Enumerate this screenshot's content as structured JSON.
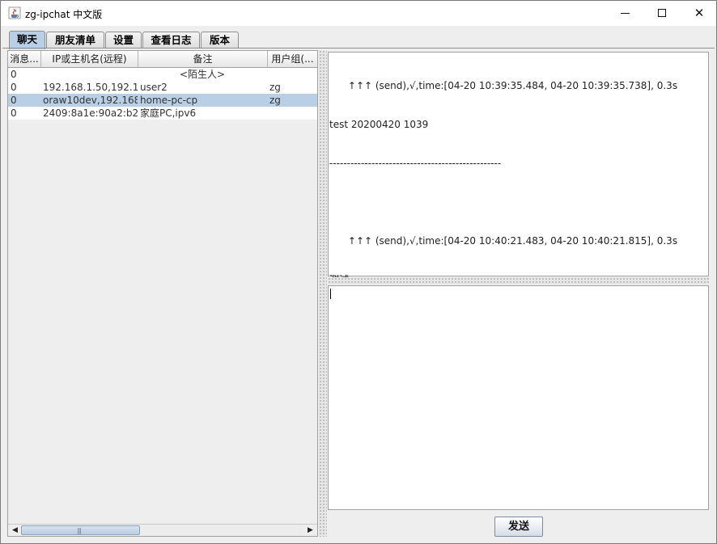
{
  "window": {
    "title": "zg-ipchat 中文版",
    "minimize_glyph": "",
    "maximize_glyph": "",
    "close_glyph": "✕"
  },
  "tabs": [
    {
      "label": "聊天",
      "active": true
    },
    {
      "label": "朋友清单",
      "active": false
    },
    {
      "label": "设置",
      "active": false
    },
    {
      "label": "查看日志",
      "active": false
    },
    {
      "label": "版本",
      "active": false
    }
  ],
  "table": {
    "columns": [
      "消息...",
      "IP或主机名(远程)",
      "备注",
      "用户组(..."
    ],
    "rows": [
      {
        "count": "0",
        "host": "",
        "note": "<陌生人>",
        "group": "",
        "selected": false
      },
      {
        "count": "0",
        "host": "192.168.1.50,192.1...",
        "note": "user2",
        "group": "zg",
        "selected": false
      },
      {
        "count": "0",
        "host": "oraw10dev,192.168...",
        "note": "home-pc-cp",
        "group": "zg",
        "selected": true
      },
      {
        "count": "0",
        "host": "2409:8a1e:90a2:b2...",
        "note": "家庭PC,ipv6",
        "group": "",
        "selected": false
      }
    ],
    "scroll_left_glyph": "◀",
    "scroll_right_glyph": "▶",
    "scroll_grip_glyph": "|||"
  },
  "messages": {
    "lines": [
      "      ↑↑↑ (send),√,time:[04-20 10:39:35.484, 04-20 10:39:35.738], 0.3s",
      "test 20200420 1039",
      "-------------------------------------------------",
      "",
      "      ↑↑↑ (send),√,time:[04-20 10:40:21.483, 04-20 10:40:21.815], 0.3s",
      "测试",
      "-------------------------------------------------"
    ]
  },
  "compose": {
    "value": ""
  },
  "send_button": {
    "label": "发送"
  },
  "icons": {
    "app": "java-cup-icon"
  }
}
